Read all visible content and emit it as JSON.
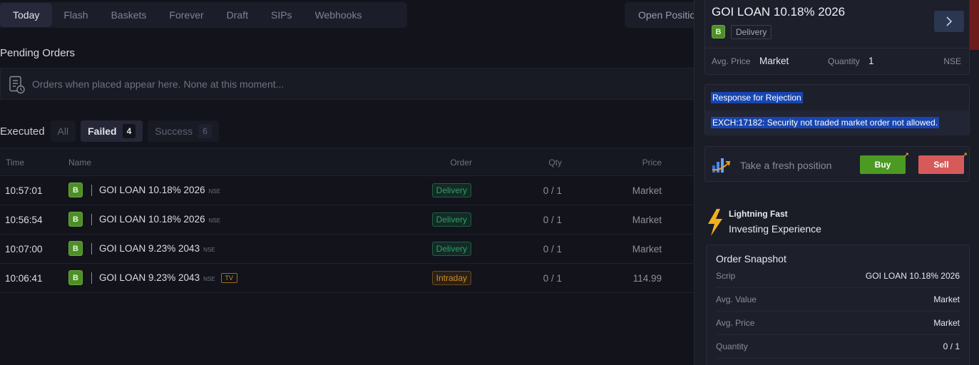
{
  "tabs": [
    "Today",
    "Flash",
    "Baskets",
    "Forever",
    "Draft",
    "SIPs",
    "Webhooks"
  ],
  "open_positions_label": "Open Positions",
  "pending": {
    "title": "Pending Orders",
    "empty_text": "Orders when placed appear here. None at this moment..."
  },
  "executed": {
    "label": "Executed",
    "filters": {
      "all": "All",
      "failed": "Failed",
      "failed_count": "4",
      "success": "Success",
      "success_count": "6"
    }
  },
  "table": {
    "headers": {
      "time": "Time",
      "name": "Name",
      "order": "Order",
      "qty": "Qty",
      "price": "Price"
    },
    "rows": [
      {
        "time": "10:57:01",
        "side": "B",
        "scrip": "GOI LOAN 10.18% 2026",
        "exchange": "NSE",
        "tag": "",
        "order": "Delivery",
        "qty": "0 / 1",
        "price": "Market"
      },
      {
        "time": "10:56:54",
        "side": "B",
        "scrip": "GOI LOAN 10.18% 2026",
        "exchange": "NSE",
        "tag": "",
        "order": "Delivery",
        "qty": "0 / 1",
        "price": "Market"
      },
      {
        "time": "10:07:00",
        "side": "B",
        "scrip": "GOI LOAN 9.23% 2043",
        "exchange": "NSE",
        "tag": "",
        "order": "Delivery",
        "qty": "0 / 1",
        "price": "Market"
      },
      {
        "time": "10:06:41",
        "side": "B",
        "scrip": "GOI LOAN 9.23% 2043",
        "exchange": "NSE",
        "tag": "TV",
        "order": "Intraday",
        "qty": "0 / 1",
        "price": "114.99"
      }
    ]
  },
  "detail": {
    "scrip": "GOI LOAN 10.18% 2026",
    "side": "B",
    "product": "Delivery",
    "avg_price_label": "Avg. Price",
    "avg_price": "Market",
    "quantity_label": "Quantity",
    "quantity": "1",
    "exchange": "NSE",
    "rejection_title": "Response for Rejection",
    "rejection_message": "EXCH:17182: Security not traded market order not allowed.",
    "fresh_text": "Take a fresh position",
    "buy_label": "Buy",
    "sell_label": "Sell",
    "promo_small": "Lightning Fast",
    "promo_big": "Investing Experience",
    "snapshot": {
      "title": "Order Snapshot",
      "rows": [
        {
          "label": "Scrip",
          "value": "GOI LOAN 10.18% 2026"
        },
        {
          "label": "Avg. Value",
          "value": "Market"
        },
        {
          "label": "Avg. Price",
          "value": "Market"
        },
        {
          "label": "Quantity",
          "value": "0 / 1"
        }
      ]
    }
  },
  "colors": {
    "buy": "#4d9a22",
    "sell": "#d65a5a",
    "highlight": "#1846b0",
    "accent": "#2b3650"
  }
}
